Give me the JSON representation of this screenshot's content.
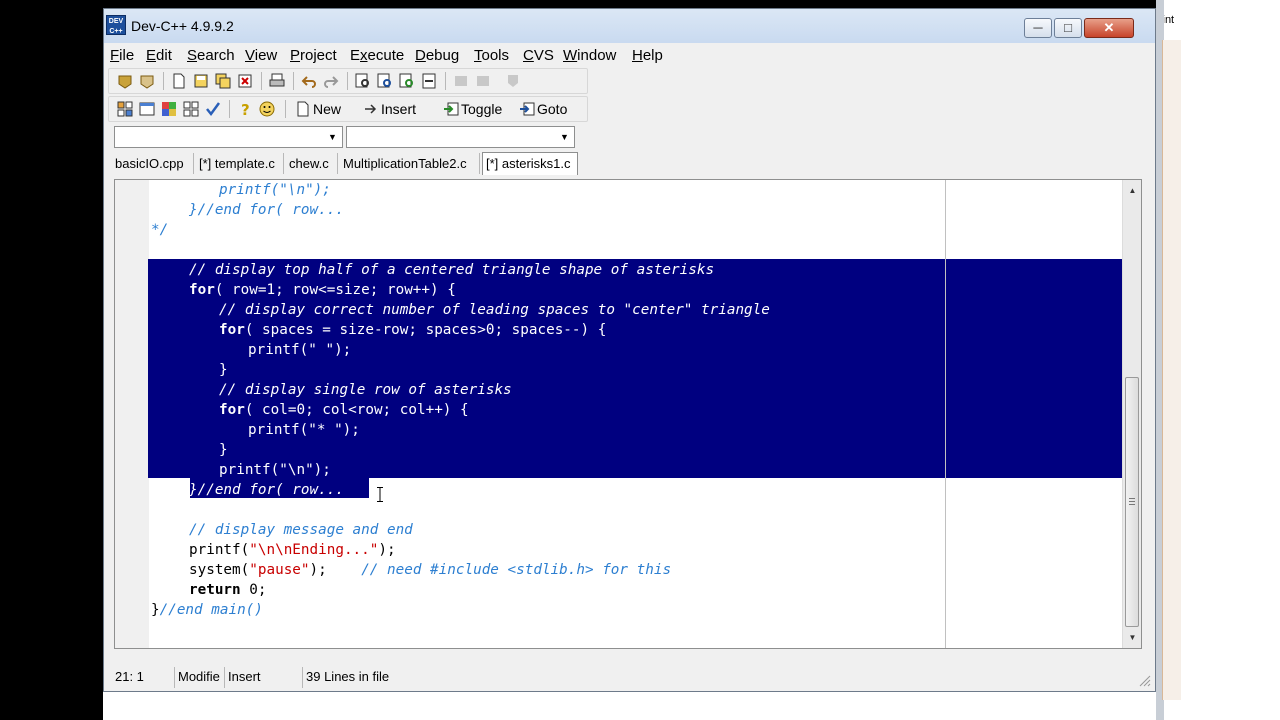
{
  "window": {
    "title": "Dev-C++ 4.9.9.2",
    "icon_text": "DEV C++"
  },
  "title_buttons": {
    "minimize": "─",
    "maximize": "□",
    "close": "✕"
  },
  "desktop": {
    "fragment_text": "l int"
  },
  "menu": [
    "File",
    "Edit",
    "Search",
    "View",
    "Project",
    "Execute",
    "Debug",
    "Tools",
    "CVS",
    "Window",
    "Help"
  ],
  "menu_underline": [
    "F",
    "E",
    "S",
    "V",
    "P",
    "x",
    "D",
    "T",
    "C",
    "W",
    "H"
  ],
  "toolbar2": {
    "new_label": "New",
    "insert_label": "Insert",
    "toggle_label": "Toggle",
    "goto_label": "Goto"
  },
  "combos": {
    "class_value": "",
    "member_value": ""
  },
  "tabs": [
    {
      "label": "basicIO.cpp",
      "active": false
    },
    {
      "label": "[*] template.c",
      "active": false
    },
    {
      "label": "chew.c",
      "active": false
    },
    {
      "label": "MultiplicationTable2.c",
      "active": false
    },
    {
      "label": "[*] asterisks1.c",
      "active": true
    }
  ],
  "code": {
    "l1": "printf(\"\\n\");",
    "l2": "}//end for( row...",
    "l3": "*/",
    "s1": "// display top half of a centered triangle shape of asterisks",
    "s2_kw": "for",
    "s2_rest": "( row=1; row<=size; row++) {",
    "s3": "// display correct number of leading spaces to \"center\" triangle",
    "s4_kw": "for",
    "s4_rest": "( spaces = size-row; spaces>0; spaces--) {",
    "s5": "printf(\" \");",
    "s6": "}",
    "s7": "// display single row of asterisks",
    "s8_kw": "for",
    "s8_rest": "( col=0; col<row; col++) {",
    "s9": "printf(\"* \");",
    "s10": "}",
    "s11": "printf(\"\\n\");",
    "s12": "}//end for( row...",
    "c1": "// display message and end",
    "c2_a": "printf(",
    "c2_s": "\"\\n\\nEnding...\"",
    "c2_b": ");",
    "c3_a": "system(",
    "c3_s": "\"pause\"",
    "c3_b": ");",
    "c3_c": "// need #include <stdlib.h> for this",
    "c4_kw": "return",
    "c4_num": " 0",
    "c4_b": ";",
    "c5_a": "}",
    "c5_c": "//end main()"
  },
  "status": {
    "position": "21: 1",
    "modified": "Modifie",
    "mode": "Insert",
    "lines": "39 Lines in file"
  }
}
